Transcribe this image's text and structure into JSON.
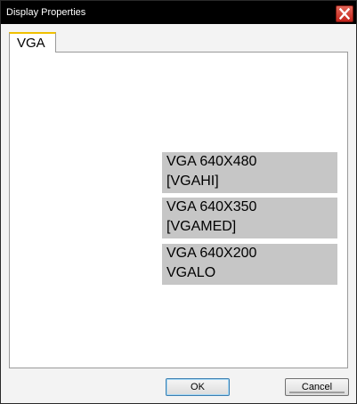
{
  "window": {
    "title": "Display Properties"
  },
  "tabs": [
    {
      "label": "VGA",
      "selected": true
    }
  ],
  "modes": [
    {
      "line1": "VGA 640X480",
      "line2": "[VGAHI]"
    },
    {
      "line1": "VGA 640X350",
      "line2": "[VGAMED]"
    },
    {
      "line1": "VGA 640X200",
      "line2": "VGALO"
    }
  ],
  "buttons": {
    "ok_label": "OK",
    "cancel_label": "Cancel"
  },
  "icons": {
    "close": "close-icon"
  },
  "colors": {
    "titlebar": "#000000",
    "close_button": "#c4231a",
    "tab_accent": "#f0c000",
    "mode_item_bg": "#c6c6c6",
    "panel_bg": "#ffffff",
    "window_bg": "#f3f3f3"
  }
}
